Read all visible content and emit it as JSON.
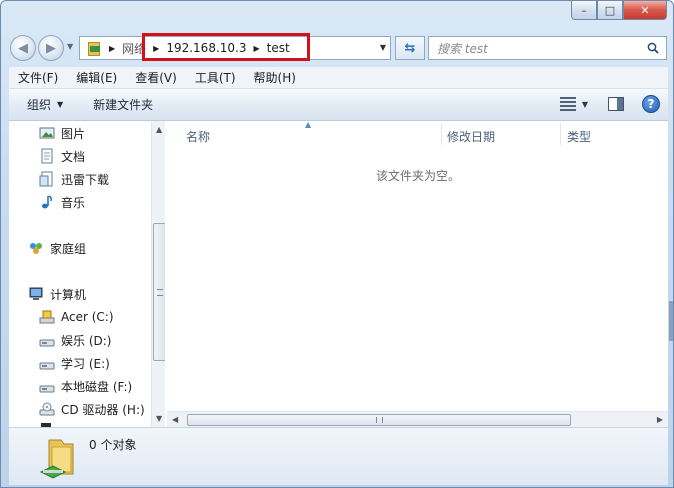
{
  "window": {
    "minimize_glyph": "–",
    "maximize_glyph": "□",
    "close_glyph": "✕"
  },
  "address_bar": {
    "crumbs": [
      "网络",
      "192.168.10.3",
      "test"
    ]
  },
  "search": {
    "placeholder": "搜索 test"
  },
  "menu": {
    "items": [
      "文件(F)",
      "编辑(E)",
      "查看(V)",
      "工具(T)",
      "帮助(H)"
    ]
  },
  "toolbar": {
    "organize_label": "组织",
    "new_folder_label": "新建文件夹"
  },
  "nav_pane": {
    "libraries": [
      "图片",
      "文档",
      "迅雷下载",
      "音乐"
    ],
    "homegroup": "家庭组",
    "computer": "计算机",
    "drives": [
      "Acer (C:)",
      "娱乐 (D:)",
      "学习 (E:)",
      "本地磁盘 (F:)",
      "CD 驱动器 (H:)"
    ]
  },
  "file_list": {
    "columns": [
      "名称",
      "修改日期",
      "类型"
    ],
    "empty_message": "该文件夹为空。"
  },
  "status": {
    "item_count": "0 个对象"
  },
  "colors": {
    "highlight_box": "#d4111a",
    "chrome_blue": "#c7dcf0"
  }
}
